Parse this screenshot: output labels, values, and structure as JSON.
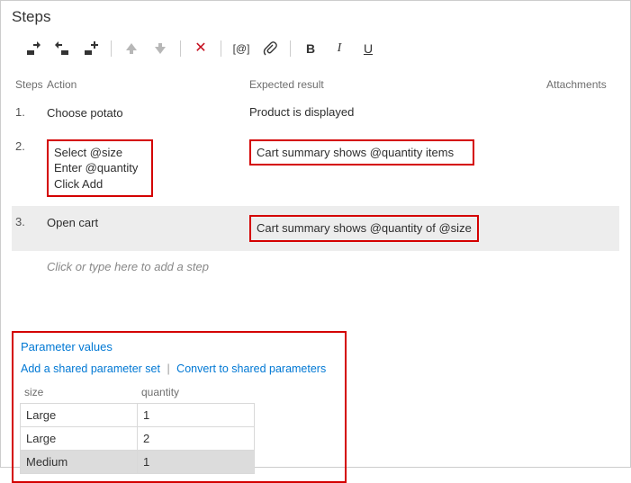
{
  "title": "Steps",
  "columns": {
    "stepsCol": "Steps",
    "actionCol": "Action",
    "expectedCol": "Expected result",
    "attachCol": "Attachments"
  },
  "steps": [
    {
      "num": "1.",
      "actionLines": [
        "Choose potato"
      ],
      "expected": "Product is displayed",
      "highlighted": false,
      "selected": false
    },
    {
      "num": "2.",
      "actionLines": [
        "Select @size",
        "Enter @quantity",
        "Click Add"
      ],
      "expected": "Cart summary shows @quantity items",
      "highlighted": true,
      "selected": false
    },
    {
      "num": "3.",
      "actionLines": [
        "Open cart"
      ],
      "expected": "Cart summary shows @quantity of @size",
      "highlighted": true,
      "highlightResultOnly": true,
      "selected": true
    }
  ],
  "placeholder": "Click or type here to add a step",
  "params": {
    "title": "Parameter values",
    "addShared": "Add a shared parameter set",
    "convert": "Convert to shared parameters",
    "headers": {
      "size": "size",
      "quantity": "quantity"
    },
    "rows": [
      {
        "size": "Large",
        "quantity": "1",
        "selected": false
      },
      {
        "size": "Large",
        "quantity": "2",
        "selected": false
      },
      {
        "size": "Medium",
        "quantity": "1",
        "selected": true
      }
    ]
  },
  "tb": {
    "at": "[@]",
    "bold": "B",
    "italic": "I",
    "underline": "U"
  }
}
